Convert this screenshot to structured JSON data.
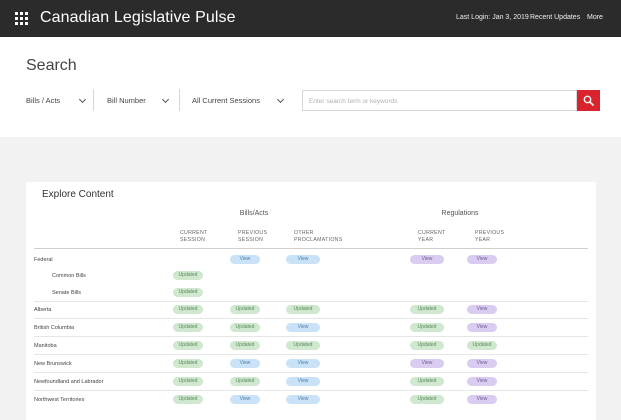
{
  "header": {
    "app_title": "Canadian Legislative Pulse",
    "last_login": "Last Login: Jan 3, 2019",
    "recent_updates": "Recent Updates",
    "more": "More"
  },
  "search": {
    "title": "Search",
    "filter_type": "Bills / Acts",
    "filter_field": "Bill Number",
    "filter_session": "All Current Sessions",
    "placeholder": "Enter search term or keywords",
    "value": ""
  },
  "explore": {
    "title": "Explore Content",
    "groups": [
      "Bills/Acts",
      "Regulations"
    ],
    "columns": [
      [
        "CURRENT",
        "SESSION"
      ],
      [
        "PREVIOUS",
        "SESSION"
      ],
      [
        "OTHER",
        "PROCLAMATIONS"
      ],
      [
        "CURRENT",
        "YEAR"
      ],
      [
        "PREVIOUS",
        "YEAR"
      ]
    ],
    "rows": [
      {
        "label": "Federal",
        "indent": false,
        "sep": false,
        "cells": [
          "",
          "View",
          "View",
          "View",
          "View"
        ]
      },
      {
        "label": "Common Bills",
        "indent": true,
        "sep": false,
        "cells": [
          "Updated",
          "",
          "",
          "",
          ""
        ]
      },
      {
        "label": "Senate Bills",
        "indent": true,
        "sep": true,
        "cells": [
          "Updated",
          "",
          "",
          "",
          ""
        ]
      },
      {
        "label": "Alberta",
        "indent": false,
        "sep": true,
        "cells": [
          "Updated",
          "Updated",
          "Updated",
          "Updated",
          "View"
        ]
      },
      {
        "label": "British Columbia",
        "indent": false,
        "sep": true,
        "cells": [
          "Updated",
          "Updated",
          "View",
          "Updated",
          "View"
        ]
      },
      {
        "label": "Manitoba",
        "indent": false,
        "sep": true,
        "cells": [
          "Updated",
          "Updated",
          "Updated",
          "Updated",
          "Updated"
        ]
      },
      {
        "label": "New Brunswick",
        "indent": false,
        "sep": true,
        "cells": [
          "Updated",
          "View",
          "View",
          "View",
          "View"
        ]
      },
      {
        "label": "Newfoundland and Labrador",
        "indent": false,
        "sep": true,
        "cells": [
          "Updated",
          "Updated",
          "View",
          "Updated",
          "View"
        ]
      },
      {
        "label": "Northwest Territories",
        "indent": false,
        "sep": false,
        "cells": [
          "Updated",
          "View",
          "View",
          "Updated",
          "View"
        ]
      }
    ]
  },
  "colors": {
    "topbar": "#2b2b2b",
    "search_button": "#d9232d",
    "updated_bg": "#cfe8cf",
    "view_blue_bg": "#c9e2f7",
    "view_purple_bg": "#d9ccf0"
  },
  "icons": {
    "app_menu": "grid-icon",
    "search": "search-icon",
    "dropdown": "chevron-down-icon"
  }
}
